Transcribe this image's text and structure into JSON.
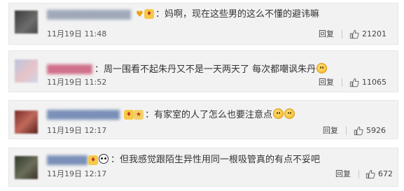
{
  "comments": [
    {
      "username": "██████████████",
      "text": "：妈啊，现在这些男的这么不懂的避讳嘛",
      "date": "11月19日 11:48",
      "reply_label": "回复",
      "likes": "21201",
      "emoji_count": 0
    },
    {
      "username": "███████",
      "text": "：周一围看不起朱丹又不是一天两天了 每次都嘲讽朱丹",
      "date": "11月19日 11:52",
      "reply_label": "回复",
      "likes": "11065",
      "emoji_count": 1
    },
    {
      "username": "████████████",
      "text": "：有家室的人了怎么也要注意点",
      "date": "11月19日 12:17",
      "reply_label": "回复",
      "likes": "5926",
      "emoji_count": 2
    },
    {
      "username": "███████",
      "text": "：但我感觉跟陌生异性用同一根吸管真的有点不妥吧",
      "date": "11月19日 12:17",
      "reply_label": "回复",
      "likes": "672",
      "emoji_count": 0
    }
  ],
  "colors": {
    "card_bg": "#f2f2f2",
    "username": "#7a90b8",
    "text": "#333333",
    "meta": "#555555"
  },
  "icons": {
    "like": "thumbs-up-icon",
    "badge": "member-badge-icon",
    "emoji": "smile-emoji-icon",
    "panda": "panda-icon"
  }
}
